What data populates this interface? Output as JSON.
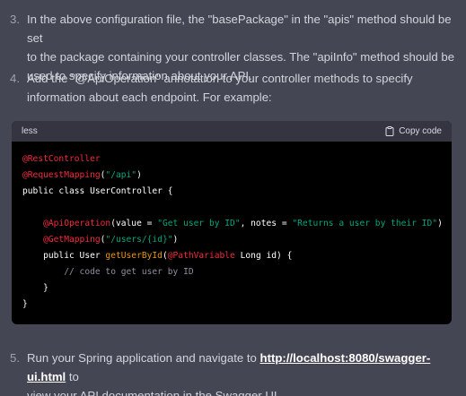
{
  "items": [
    {
      "number": "3.",
      "line1": "In the above configuration file, the \"basePackage\" in the \"apis\" method should be set",
      "line2": "to the package containing your controller classes. The \"apiInfo\" method should be",
      "line3": "used to specify information about your API."
    },
    {
      "number": "4.",
      "line1": "Add the \"@ApiOperation\" annotation to your controller methods to specify",
      "line2": "information about each endpoint. For example:"
    },
    {
      "number": "5.",
      "line1_before": "Run your Spring application and navigate to ",
      "link": "http://localhost:8080/swagger-ui.html",
      "line1_after": " to",
      "line2": "view your API documentation in the Swagger UI."
    }
  ],
  "code": {
    "language": "less",
    "copy_label": "Copy code",
    "copy_icon": "clipboard-icon",
    "lines": {
      "l1_ann": "@RestController",
      "l2_ann": "@RequestMapping",
      "l2_p1": "(",
      "l2_str": "\"/api\"",
      "l2_p2": ")",
      "l3": "public class UserController {",
      "l5_indent": "    ",
      "l5_ann": "@ApiOperation",
      "l5_p1": "(value = ",
      "l5_str1": "\"Get user by ID\"",
      "l5_p2": ", notes = ",
      "l5_str2": "\"Returns a user by their ID\"",
      "l5_p3": ")",
      "l6_indent": "    ",
      "l6_ann": "@GetMapping",
      "l6_p1": "(",
      "l6_str": "\"/users/{id}\"",
      "l6_p2": ")",
      "l7_indent": "    ",
      "l7_p1": "public User ",
      "l7_fn": "getUserById",
      "l7_p2": "(",
      "l7_ann": "@PathVariable",
      "l7_p3": " Long id) {",
      "l8_indent": "        ",
      "l8_com": "// code to get user by ID",
      "l9": "    }",
      "l10": "}"
    }
  },
  "colors": {
    "background": "#444654",
    "code_bg": "#000000",
    "code_header_bg": "#343541",
    "annotation": "#f22c3d",
    "string": "#00a67d",
    "function": "#e9950c"
  }
}
